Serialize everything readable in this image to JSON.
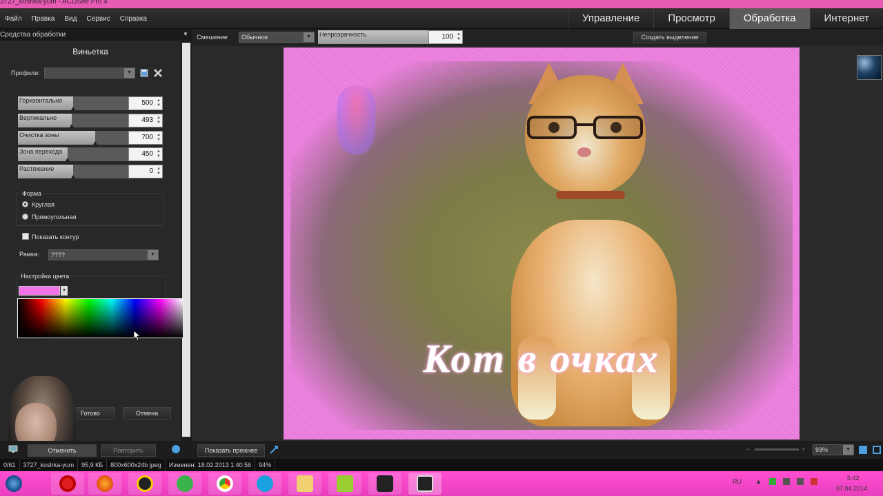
{
  "titlebar": {
    "title": "3727_koshka-yum - ACDSee Pro 4"
  },
  "menu": [
    "Файл",
    "Правка",
    "Вид",
    "Сервис",
    "Справка"
  ],
  "modes": [
    {
      "label": "Управление",
      "active": false
    },
    {
      "label": "Просмотр",
      "active": false
    },
    {
      "label": "Обработка",
      "active": true
    },
    {
      "label": "Интернет",
      "active": false
    }
  ],
  "panel": {
    "title": "Средства обработки",
    "heading": "Виньетка",
    "profiles_label": "Профили:",
    "profiles_value": "",
    "sliders": [
      {
        "label": "Горизонтально",
        "value": "500",
        "level": 0.5
      },
      {
        "label": "Вертикально",
        "value": "493",
        "level": 0.49
      },
      {
        "label": "Очистка зоны",
        "value": "700",
        "level": 0.7
      },
      {
        "label": "Зона перехода",
        "value": "450",
        "level": 0.45
      },
      {
        "label": "Растяжение",
        "value": "0",
        "level": 0.5
      }
    ],
    "shape_group": "Форма",
    "shape_round": "Круглая",
    "shape_rect": "Прямоугольная",
    "show_outline": "Показать контур",
    "frame_label": "Рамка:",
    "frame_value": "????",
    "color_group": "Настройки цвета",
    "swatch_color": "#f272e8",
    "done_button": "Готово",
    "cancel_button": "Отмена",
    "undo_button": "Отменить",
    "redo_button": "Повторить"
  },
  "toolbar": {
    "blend_label": "Смешение",
    "blend_value": "Обычное",
    "opacity_label": "Непрозрачность",
    "opacity_value": "100",
    "create_selection": "Создать выделение"
  },
  "image": {
    "caption": "Кот  в  очках"
  },
  "bottombar": {
    "show_before": "Показать прежнее",
    "zoom": "93%"
  },
  "status": [
    "0/61",
    "3727_koshka-yum",
    "95,9 КБ",
    "800x600x24b jpeg",
    "Изменен: 18.02.2013 1:40:56",
    "94%"
  ],
  "tray": {
    "lang": "RU",
    "time": "5:42",
    "date": "07.04.2014"
  }
}
